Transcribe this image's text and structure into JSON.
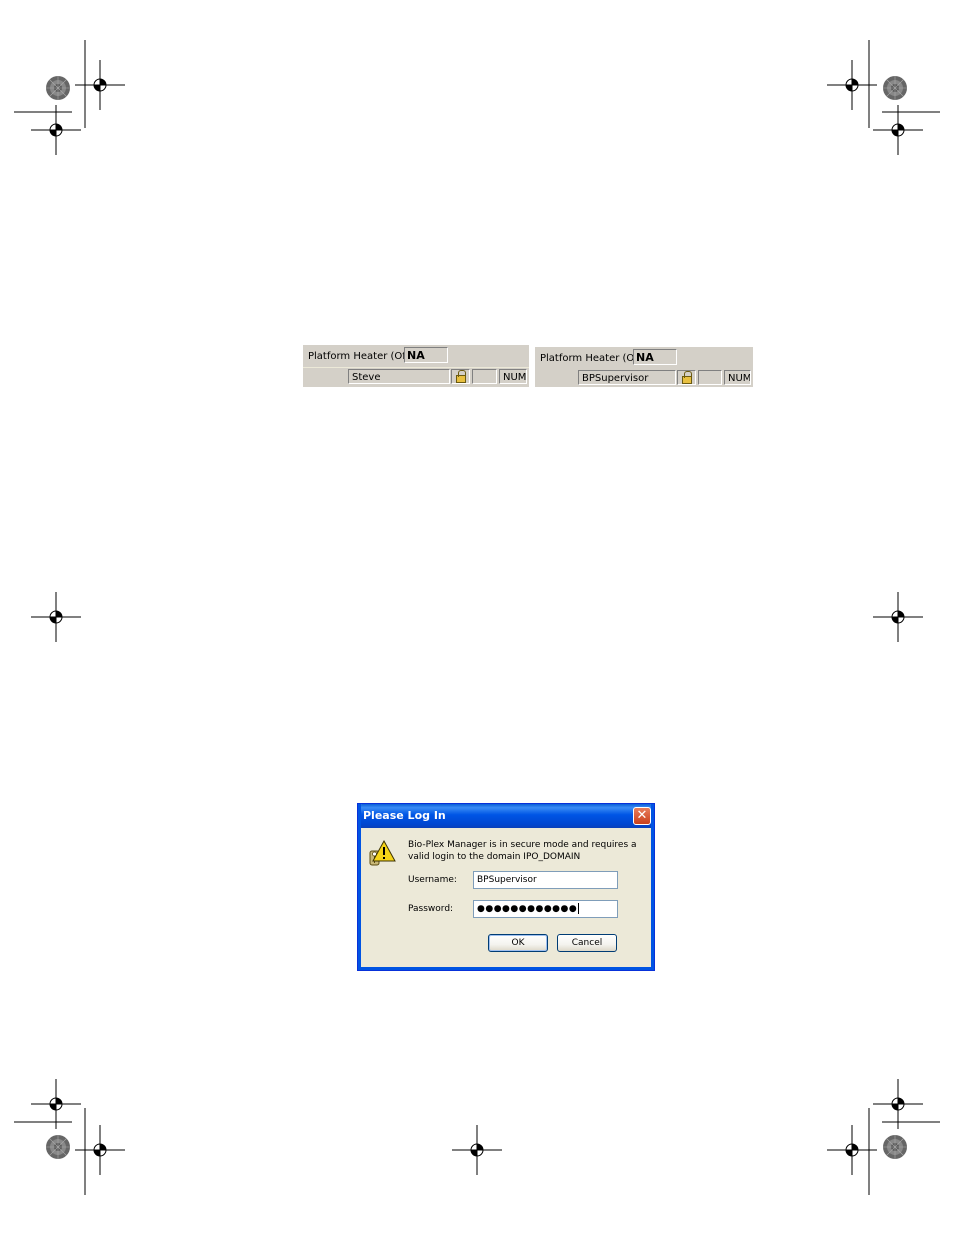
{
  "statusbars": [
    {
      "heater_label": "Platform Heater (Off):",
      "heater_value": "NA",
      "user": "Steve",
      "lock_state": "unlocked",
      "num_label": "NUM"
    },
    {
      "heater_label": "Platform Heater (Off):",
      "heater_value": "NA",
      "user": "BPSupervisor",
      "lock_state": "locked",
      "num_label": "NUM"
    }
  ],
  "dialog": {
    "title": "Please Log In",
    "close_glyph": "✕",
    "message_line1": "Bio-Plex Manager is in secure mode and requires a",
    "message_line2": "valid login to the domain  IPO_DOMAIN",
    "username_label": "Username:",
    "username_value": "BPSupervisor",
    "password_label": "Password:",
    "password_value": "●●●●●●●●●●●●",
    "ok_label": "OK",
    "cancel_label": "Cancel",
    "icon": "warning-key-icon"
  },
  "colors": {
    "titlebar": "#0055e5",
    "dialog_bg": "#ece9d8",
    "statusbar_bg": "#d4d0c8",
    "close_button": "#c9401c"
  }
}
